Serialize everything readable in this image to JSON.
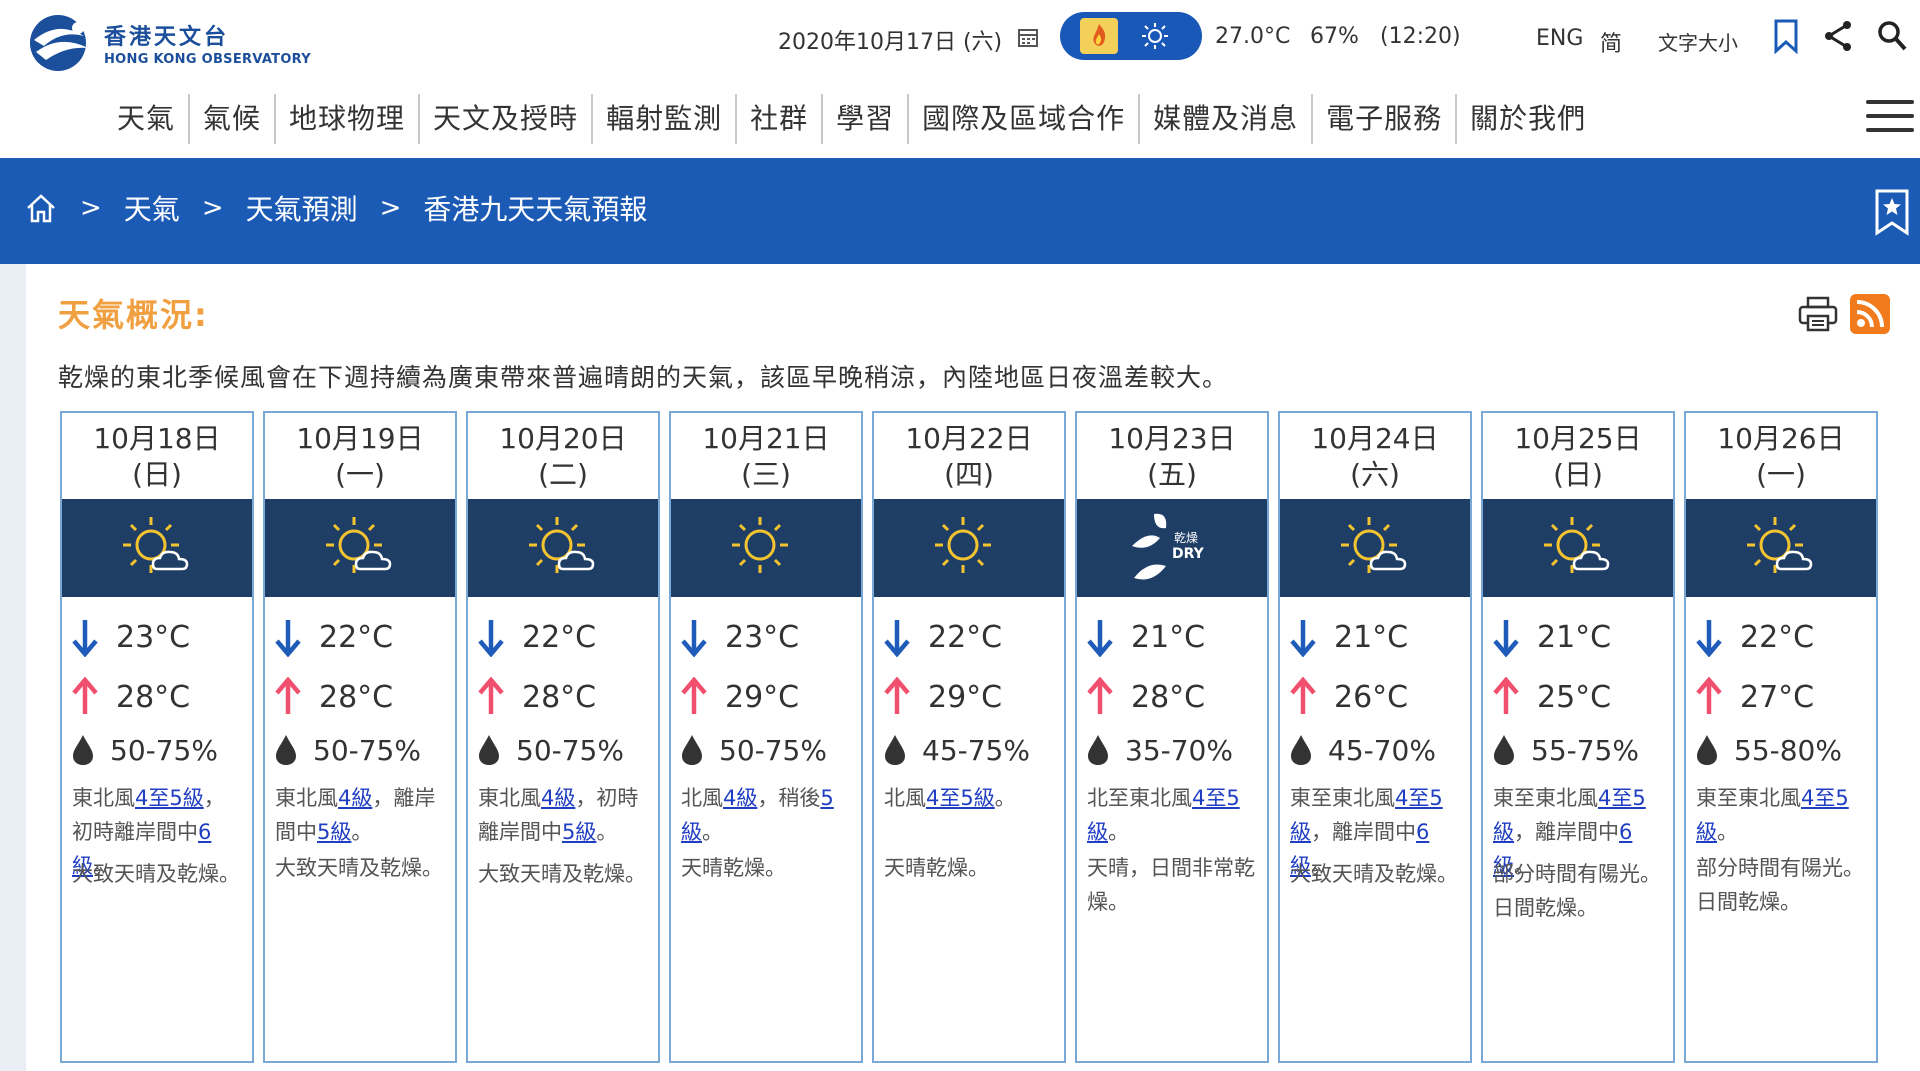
{
  "header": {
    "logo_zh": "香港天文台",
    "logo_en": "HONG KONG OBSERVATORY",
    "date": "2020年10月17日 (六)",
    "temperature": "27.0°C",
    "humidity": "67%",
    "time": "(12:20)",
    "lang_en": "ENG",
    "lang_sc": "简",
    "font_size": "文字大小"
  },
  "nav": {
    "items": [
      "天氣",
      "氣候",
      "地球物理",
      "天文及授時",
      "輻射監測",
      "社群",
      "學習",
      "國際及區域合作",
      "媒體及消息",
      "電子服務",
      "關於我們"
    ]
  },
  "breadcrumb": {
    "items": [
      "天氣",
      "天氣預測",
      "香港九天天氣預報"
    ],
    "separator": ">"
  },
  "section": {
    "title": "天氣概況:",
    "summary": "乾燥的東北季候風會在下週持續為廣東帶來普遍晴朗的天氣，該區早晚稍涼，內陸地區日夜溫差較大。"
  },
  "forecast": [
    {
      "date": "10月18日",
      "weekday": "(日)",
      "icon": "sunny-periods-icon",
      "min": "23°C",
      "max": "28°C",
      "humidity": "50-75%",
      "wind": [
        {
          "t": "東北風"
        },
        {
          "t": "4至5級",
          "link": true
        },
        {
          "t": "，初時離岸間中"
        },
        {
          "t": "6級",
          "link": true
        },
        {
          "t": "。"
        }
      ],
      "weather": "大致天晴及乾燥。"
    },
    {
      "date": "10月19日",
      "weekday": "(一)",
      "icon": "sunny-periods-icon",
      "min": "22°C",
      "max": "28°C",
      "humidity": "50-75%",
      "wind": [
        {
          "t": "東北風"
        },
        {
          "t": "4級",
          "link": true
        },
        {
          "t": "，離岸間中"
        },
        {
          "t": "5級",
          "link": true
        },
        {
          "t": "。"
        }
      ],
      "weather": "大致天晴及乾燥。"
    },
    {
      "date": "10月20日",
      "weekday": "(二)",
      "icon": "sunny-periods-icon",
      "min": "22°C",
      "max": "28°C",
      "humidity": "50-75%",
      "wind": [
        {
          "t": "東北風"
        },
        {
          "t": "4級",
          "link": true
        },
        {
          "t": "，初時離岸間中"
        },
        {
          "t": "5級",
          "link": true
        },
        {
          "t": "。"
        }
      ],
      "weather": "大致天晴及乾燥。"
    },
    {
      "date": "10月21日",
      "weekday": "(三)",
      "icon": "sunny-icon",
      "min": "23°C",
      "max": "29°C",
      "humidity": "50-75%",
      "wind": [
        {
          "t": "北風"
        },
        {
          "t": "4級",
          "link": true
        },
        {
          "t": "，稍後"
        },
        {
          "t": "5級",
          "link": true
        },
        {
          "t": "。"
        }
      ],
      "weather": "天晴乾燥。"
    },
    {
      "date": "10月22日",
      "weekday": "(四)",
      "icon": "sunny-icon",
      "min": "22°C",
      "max": "29°C",
      "humidity": "45-75%",
      "wind": [
        {
          "t": "北風"
        },
        {
          "t": "4至5級",
          "link": true
        },
        {
          "t": "。"
        }
      ],
      "weather": "天晴乾燥。"
    },
    {
      "date": "10月23日",
      "weekday": "(五)",
      "icon": "dry-icon",
      "min": "21°C",
      "max": "28°C",
      "humidity": "35-70%",
      "wind": [
        {
          "t": "北至東北風"
        },
        {
          "t": "4至5級",
          "link": true
        },
        {
          "t": "。"
        }
      ],
      "weather": "天晴，日間非常乾燥。"
    },
    {
      "date": "10月24日",
      "weekday": "(六)",
      "icon": "sunny-periods-icon",
      "min": "21°C",
      "max": "26°C",
      "humidity": "45-70%",
      "wind": [
        {
          "t": "東至東北風"
        },
        {
          "t": "4至5級",
          "link": true
        },
        {
          "t": "，離岸間中"
        },
        {
          "t": "6級",
          "link": true
        },
        {
          "t": "。"
        }
      ],
      "weather": "大致天晴及乾燥。"
    },
    {
      "date": "10月25日",
      "weekday": "(日)",
      "icon": "sunny-periods-icon",
      "min": "21°C",
      "max": "25°C",
      "humidity": "55-75%",
      "wind": [
        {
          "t": "東至東北風"
        },
        {
          "t": "4至5級",
          "link": true
        },
        {
          "t": "，離岸間中"
        },
        {
          "t": "6級",
          "link": true
        },
        {
          "t": "。"
        }
      ],
      "weather": "部分時間有陽光。日間乾燥。"
    },
    {
      "date": "10月26日",
      "weekday": "(一)",
      "icon": "sunny-periods-icon",
      "min": "22°C",
      "max": "27°C",
      "humidity": "55-80%",
      "wind": [
        {
          "t": "東至東北風"
        },
        {
          "t": "4至5級",
          "link": true
        },
        {
          "t": "。"
        }
      ],
      "weather": "部分時間有陽光。日間乾燥。"
    }
  ],
  "dry_icon_label_zh": "乾燥",
  "dry_icon_label_en": "DRY",
  "colors": {
    "brand_blue": "#1b5bb5",
    "icon_bg": "#1f3e66",
    "title_orange": "#f0a040",
    "min_arrow": "#1f5bb8",
    "max_arrow": "#f0506e"
  }
}
